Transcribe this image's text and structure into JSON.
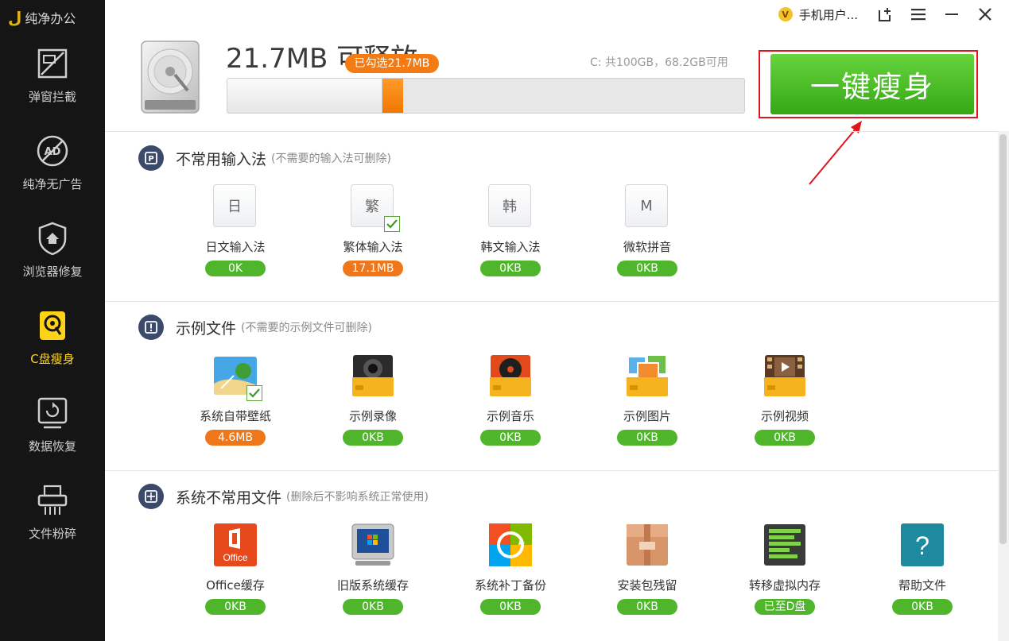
{
  "sidebar": {
    "logo_text": "纯净办公",
    "items": [
      {
        "label": "弹窗拦截",
        "icon": "popup-block-icon"
      },
      {
        "label": "纯净无广告",
        "icon": "no-ads-icon"
      },
      {
        "label": "浏览器修复",
        "icon": "browser-repair-icon"
      },
      {
        "label": "C盘瘦身",
        "icon": "disk-slim-icon",
        "active": true
      },
      {
        "label": "数据恢复",
        "icon": "data-recovery-icon"
      },
      {
        "label": "文件粉碎",
        "icon": "file-shredder-icon"
      }
    ]
  },
  "topbar": {
    "user_label": "手机用户...",
    "vip_badge": "V",
    "icons": [
      "new-window-icon",
      "menu-icon",
      "minimize-icon",
      "close-icon"
    ]
  },
  "header": {
    "free_title": "21.7MB 可释放",
    "disk_info": "C: 共100GB，68.2GB可用",
    "selected_tag": "已勾选21.7MB",
    "progress_fraction": 0.3,
    "slim_button_label": "一键瘦身"
  },
  "sections": [
    {
      "title": "不常用输入法",
      "note": "(不需要的输入法可删除)",
      "icon": "keyboard-p-icon",
      "items": [
        {
          "label": "日文输入法",
          "size": "0K",
          "glyph": "日",
          "checked": false
        },
        {
          "label": "繁体输入法",
          "size": "17.1MB",
          "glyph": "繁",
          "checked": true
        },
        {
          "label": "韩文输入法",
          "size": "0KB",
          "glyph": "韩",
          "checked": false
        },
        {
          "label": "微软拼音",
          "size": "0KB",
          "glyph": "M",
          "checked": false
        }
      ]
    },
    {
      "title": "示例文件",
      "note": "(不需要的示例文件可删除)",
      "icon": "alert-icon",
      "items": [
        {
          "label": "系统自带壁纸",
          "size": "4.6MB",
          "icon": "wallpaper-icon",
          "checked": true
        },
        {
          "label": "示例录像",
          "size": "0KB",
          "icon": "sample-video-record-icon",
          "checked": false
        },
        {
          "label": "示例音乐",
          "size": "0KB",
          "icon": "sample-music-icon",
          "checked": false
        },
        {
          "label": "示例图片",
          "size": "0KB",
          "icon": "sample-pictures-icon",
          "checked": false
        },
        {
          "label": "示例视频",
          "size": "0KB",
          "icon": "sample-videos-icon",
          "checked": false
        }
      ]
    },
    {
      "title": "系统不常用文件",
      "note": "(删除后不影响系统正常使用)",
      "icon": "windows-grid-icon",
      "items": [
        {
          "label": "Office缓存",
          "size": "0KB",
          "icon": "office-icon",
          "icon_text": "Office",
          "checked": false
        },
        {
          "label": "旧版系统缓存",
          "size": "0KB",
          "icon": "old-system-cache-icon",
          "checked": false
        },
        {
          "label": "系统补丁备份",
          "size": "0KB",
          "icon": "patch-backup-icon",
          "checked": false
        },
        {
          "label": "安装包残留",
          "size": "0KB",
          "icon": "installer-package-icon",
          "checked": false
        },
        {
          "label": "转移虚拟内存",
          "size": "已至D盘",
          "icon": "virtual-memory-icon",
          "checked": false
        },
        {
          "label": "帮助文件",
          "size": "0KB",
          "icon": "help-file-icon",
          "icon_text": "?",
          "checked": false
        }
      ]
    }
  ],
  "colors": {
    "sidebar_bg": "#151515",
    "active": "#ffd21a",
    "green": "#4fb62c",
    "orange": "#f0761a",
    "annotation_red": "#e0151b"
  }
}
